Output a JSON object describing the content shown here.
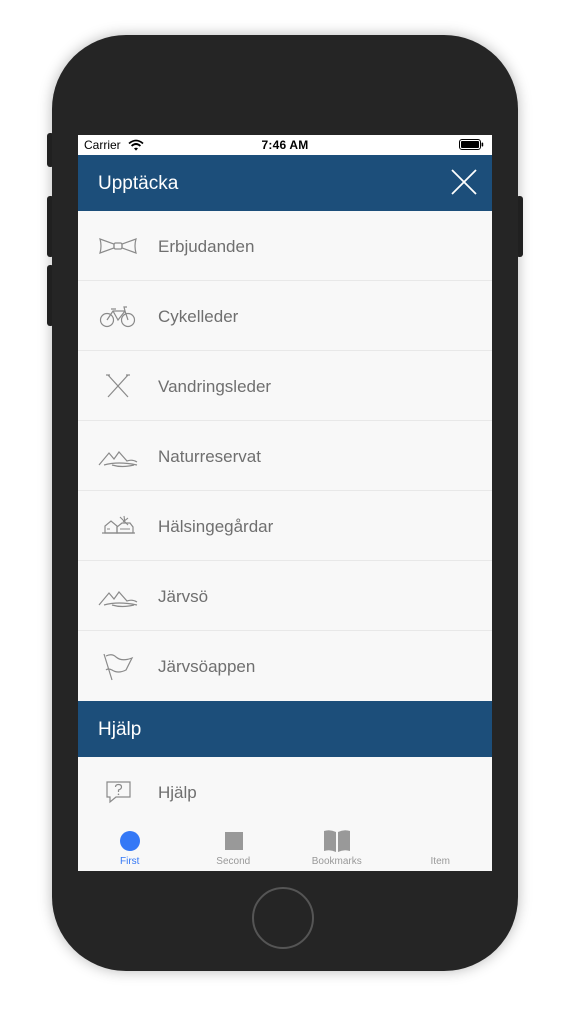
{
  "status_bar": {
    "carrier": "Carrier",
    "time": "7:46 AM",
    "icons": [
      "wifi-icon",
      "battery-icon"
    ]
  },
  "discover_header": {
    "title": "Upptäcka",
    "close_icon": "close-icon"
  },
  "discover_items": [
    {
      "label": "Erbjudanden",
      "icon": "bowtie-icon"
    },
    {
      "label": "Cykelleder",
      "icon": "bicycle-icon"
    },
    {
      "label": "Vandringsleder",
      "icon": "crossed-poles-icon"
    },
    {
      "label": "Naturreservat",
      "icon": "mountains-icon"
    },
    {
      "label": "Hälsingegårdar",
      "icon": "farmhouse-icon"
    },
    {
      "label": "Järvsö",
      "icon": "mountains-icon"
    },
    {
      "label": "Järvsöappen",
      "icon": "flag-icon"
    }
  ],
  "help_header": {
    "title": "Hjälp"
  },
  "help_items": [
    {
      "label": "Hjälp",
      "icon": "question-bubble-icon"
    }
  ],
  "tab_bar": {
    "active_tab": "First",
    "tabs": [
      {
        "label": "First",
        "icon": "circle-icon"
      },
      {
        "label": "Second",
        "icon": "square-icon"
      },
      {
        "label": "Bookmarks",
        "icon": "book-icon"
      },
      {
        "label": "Item",
        "icon": ""
      }
    ]
  },
  "colors": {
    "header_blue": "#1c4e7a",
    "active_tab_blue": "#3478f6",
    "inactive_tab_gray": "#999999",
    "item_text_gray": "#6f6f6f",
    "device_body": "#252525"
  }
}
